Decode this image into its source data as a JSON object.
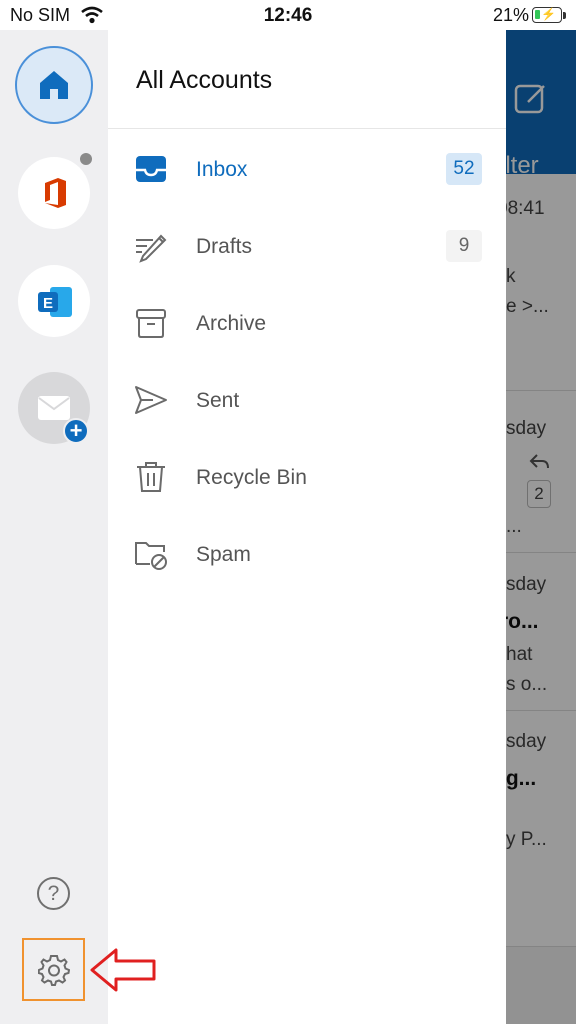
{
  "status_bar": {
    "carrier": "No SIM",
    "time": "12:46",
    "battery_percent": "21%",
    "battery_level": 0.21,
    "icons": [
      "wifi-icon",
      "battery-charging-icon"
    ]
  },
  "accounts": [
    {
      "name": "home",
      "icon": "home-icon",
      "selected": true
    },
    {
      "name": "office",
      "icon": "office-logo-icon",
      "has_notification": true
    },
    {
      "name": "exchange",
      "icon": "exchange-logo-icon",
      "icon_letter": "E"
    },
    {
      "name": "add-mail-account",
      "icon": "mail-envelope-icon",
      "badge": "+"
    }
  ],
  "rail_bottom": {
    "help_label": "?",
    "help_icon": "help-icon",
    "settings_icon": "gear-icon"
  },
  "panel": {
    "title": "All Accounts",
    "folders": [
      {
        "label": "Inbox",
        "count": "52",
        "icon": "inbox-icon",
        "active": true
      },
      {
        "label": "Drafts",
        "count": "9",
        "icon": "drafts-pencil-icon"
      },
      {
        "label": "Archive",
        "icon": "archive-box-icon"
      },
      {
        "label": "Sent",
        "icon": "sent-paper-plane-icon"
      },
      {
        "label": "Recycle Bin",
        "icon": "trash-icon"
      },
      {
        "label": "Spam",
        "icon": "spam-folder-icon"
      }
    ]
  },
  "background_list": {
    "header_text": "ilter",
    "compose_icon": "compose-icon",
    "snippets": [
      "08:41",
      "k",
      "e >...",
      "sday",
      "2",
      "...",
      "sday",
      "ro...",
      "hat",
      "s o...",
      "sday",
      "ig...",
      "y P..."
    ],
    "accent_color": "#0f6cbd"
  },
  "annotation": {
    "arrow_color": "#e02020",
    "highlight_color": "#f0922f"
  }
}
